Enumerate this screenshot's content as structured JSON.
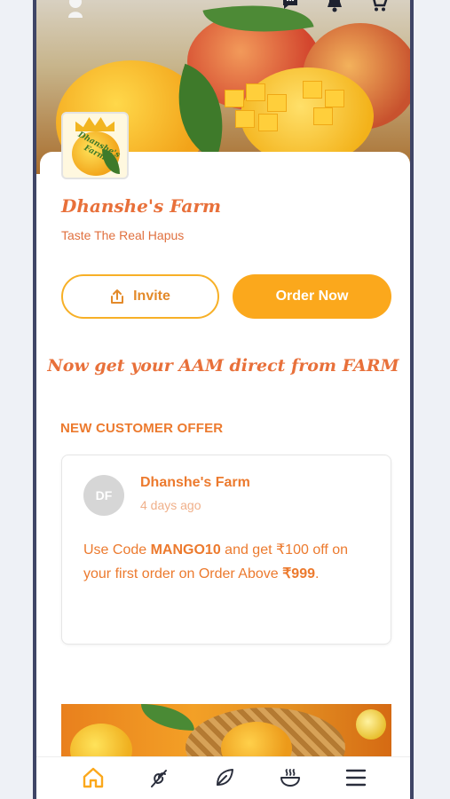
{
  "header": {
    "icons": [
      "user-icon",
      "chat-icon",
      "bell-icon",
      "cart-icon"
    ]
  },
  "farm": {
    "name": "Dhanshe's Farm",
    "tagline": "Taste The Real Hapus",
    "logo_text": "Dhanshe's Farm"
  },
  "actions": {
    "invite_label": "Invite",
    "order_label": "Order Now"
  },
  "promo_text": "Now get your AAM direct from FARM",
  "offer_section": {
    "title": "NEW CUSTOMER OFFER",
    "card": {
      "avatar_initials": "DF",
      "poster": "Dhanshe's Farm",
      "time": "4 days ago",
      "text_prefix": "Use Code ",
      "code": "MANGO10",
      "text_middle": " and get  ₹100 off on your first order on Order Above ",
      "min_amount": "₹999",
      "text_suffix": "."
    }
  },
  "bottom_nav": {
    "items": [
      "home-icon",
      "plant-icon",
      "leaf-icon",
      "bowl-icon",
      "menu-icon"
    ],
    "active": "home-icon"
  },
  "colors": {
    "accent_orange": "#fba81c",
    "text_orange": "#ec7a2e",
    "frame": "#3f4566"
  }
}
